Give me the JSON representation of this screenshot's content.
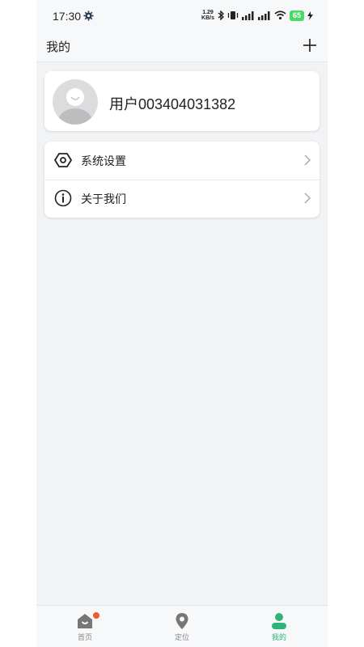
{
  "status_bar": {
    "time": "17:30",
    "net_speed_value": "1.29",
    "net_speed_unit": "KB/s",
    "battery": "65"
  },
  "header": {
    "title": "我的",
    "add_icon": "plus-icon"
  },
  "profile": {
    "username": "用户003404031382",
    "avatar_icon": "default-avatar-icon"
  },
  "menu": {
    "items": [
      {
        "label": "系统设置",
        "icon": "hexagon-settings-icon"
      },
      {
        "label": "关于我们",
        "icon": "info-circle-icon"
      }
    ]
  },
  "bottom_nav": {
    "items": [
      {
        "label": "首页",
        "icon": "home-icon",
        "badge": true
      },
      {
        "label": "定位",
        "icon": "location-pin-icon"
      },
      {
        "label": "我的",
        "icon": "person-icon",
        "active": true
      }
    ]
  },
  "colors": {
    "accent": "#2fb37a",
    "badge": "#f05a28",
    "battery": "#4cd964",
    "background": "#f2f3f5"
  }
}
